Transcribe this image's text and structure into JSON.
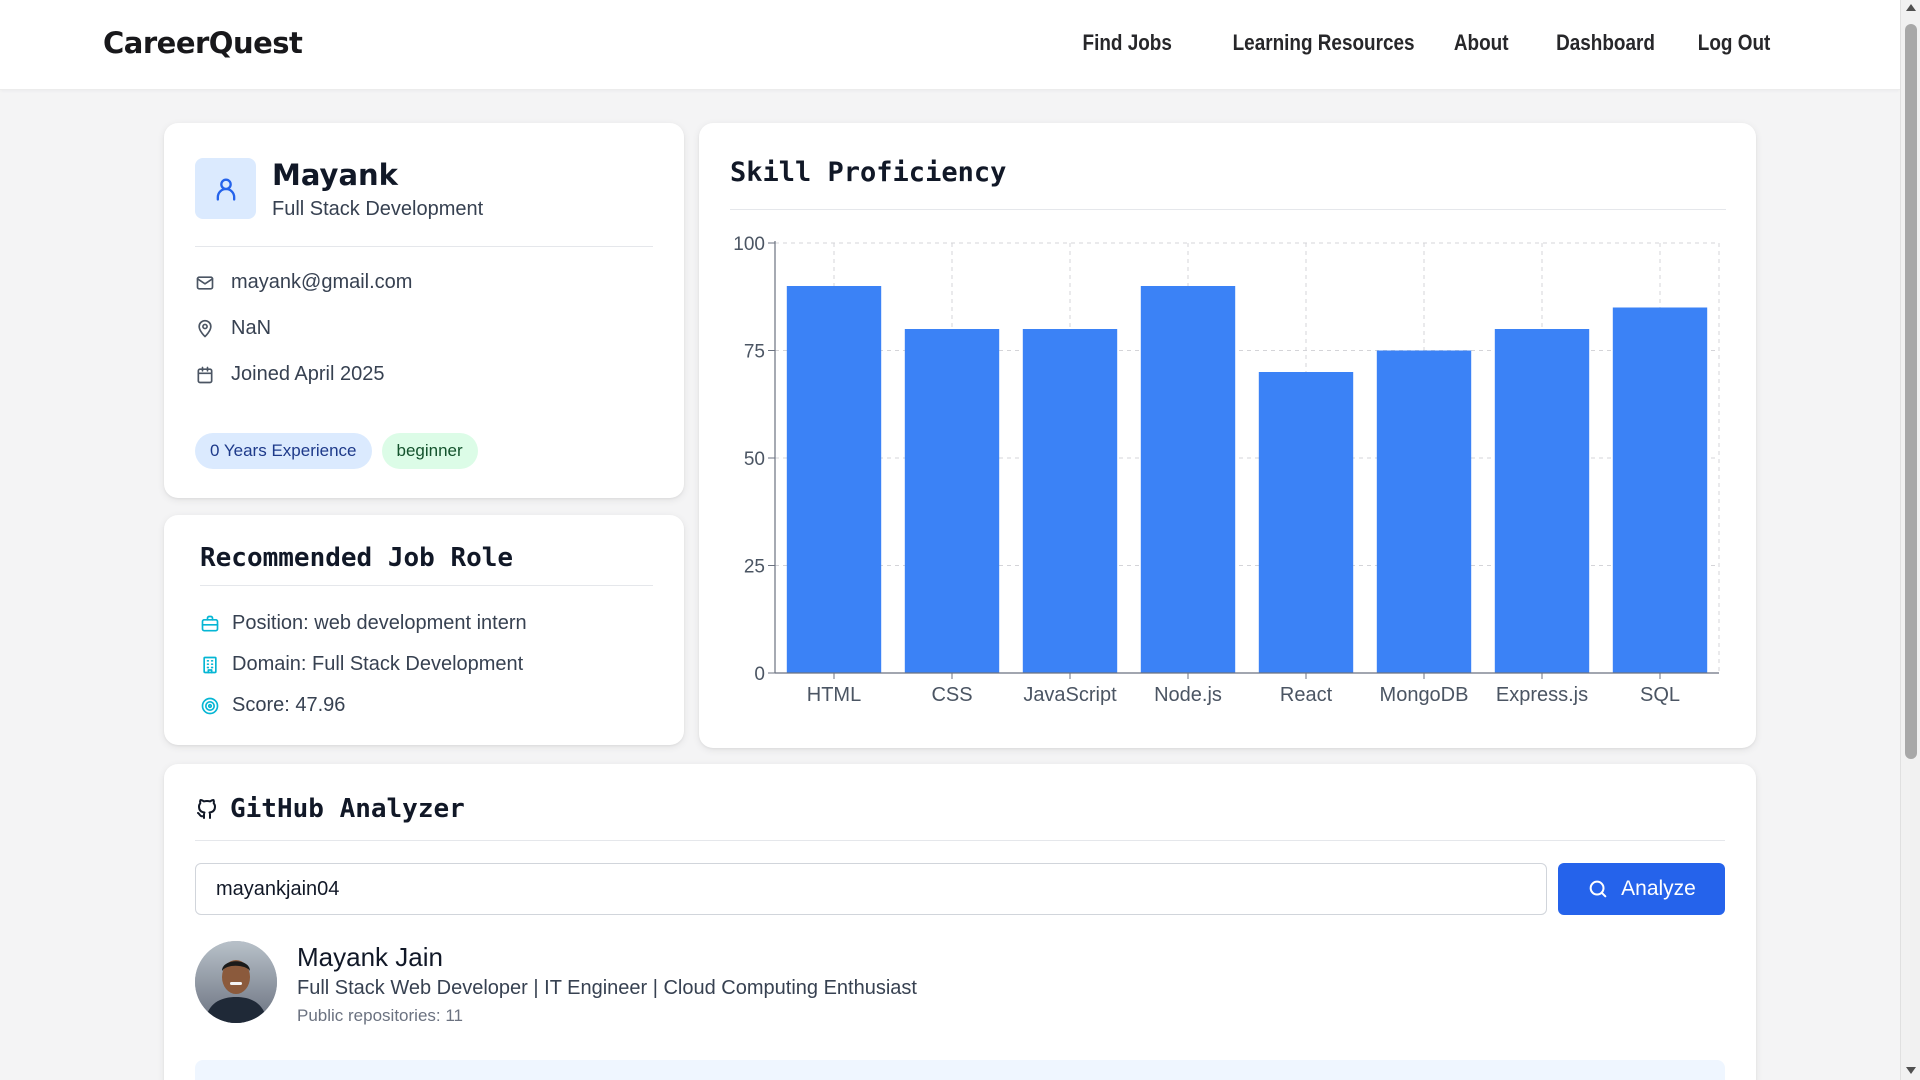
{
  "header": {
    "logo": "CareerQuest",
    "nav": [
      "Find Jobs",
      "Learning Resources",
      "About",
      "Dashboard",
      "Log Out"
    ]
  },
  "profile": {
    "name": "Mayank",
    "domain": "Full Stack Development",
    "email": "mayank@gmail.com",
    "location": "NaN",
    "joined": "Joined April 2025",
    "experience_badge": "0 Years Experience",
    "level_badge": "beginner"
  },
  "recommended": {
    "title": "Recommended Job Role",
    "position": "Position: web development intern",
    "domain": "Domain: Full Stack Development",
    "score": "Score: 47.96"
  },
  "skills": {
    "title": "Skill Proficiency"
  },
  "chart_data": {
    "type": "bar",
    "title": "Skill Proficiency",
    "categories": [
      "HTML",
      "CSS",
      "JavaScript",
      "Node.js",
      "React",
      "MongoDB",
      "Express.js",
      "SQL"
    ],
    "values": [
      90,
      80,
      80,
      90,
      70,
      75,
      80,
      85
    ],
    "ylim": [
      0,
      100
    ],
    "yticks": [
      0,
      25,
      50,
      75,
      100
    ],
    "grid": true,
    "bar_color": "#3b82f6"
  },
  "github": {
    "title": "GitHub Analyzer",
    "username_value": "mayankjain04",
    "analyze_label": "Analyze",
    "user_name": "Mayank Jain",
    "bio": "Full Stack Web Developer | IT Engineer | Cloud Computing Enthusiast",
    "repos": "Public repositories: 11"
  },
  "colors": {
    "accent": "#2563eb",
    "bar": "#3b82f6",
    "icon_teal": "#06b6d4"
  },
  "icons": {
    "avatar": "user-icon",
    "email": "mail-icon",
    "location": "map-pin-icon",
    "joined": "calendar-icon",
    "position": "briefcase-icon",
    "domain": "building-icon",
    "score": "target-icon",
    "github": "github-icon",
    "search": "search-icon"
  }
}
